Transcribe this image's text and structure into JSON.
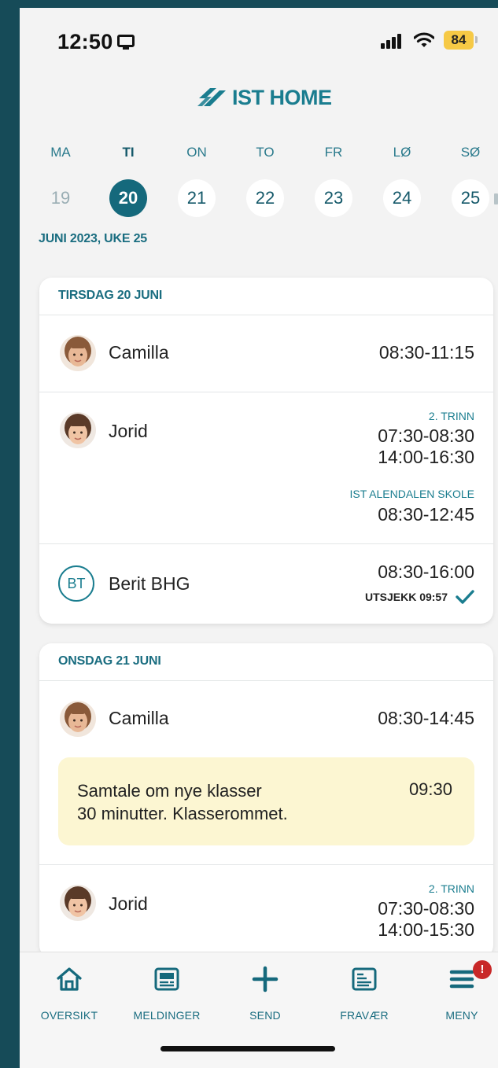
{
  "status_bar": {
    "time": "12:50",
    "battery": "84",
    "icons": [
      "screen-icon",
      "signal-icon",
      "wifi-icon"
    ]
  },
  "app": {
    "logo_text": "IST HOME",
    "accent": "#1a7d8f",
    "dark_accent": "#15697c"
  },
  "week": {
    "label": "JUNI 2023, UKE 25",
    "days": [
      {
        "name": "MA",
        "num": "19"
      },
      {
        "name": "TI",
        "num": "20"
      },
      {
        "name": "ON",
        "num": "21"
      },
      {
        "name": "TO",
        "num": "22"
      },
      {
        "name": "FR",
        "num": "23"
      },
      {
        "name": "LØ",
        "num": "24"
      },
      {
        "name": "SØ",
        "num": "25"
      }
    ]
  },
  "cards": [
    {
      "header": "TIRSDAG 20 JUNI",
      "rows": [
        {
          "name": "Camilla",
          "time": "08:30-11:15"
        },
        {
          "name": "Jorid",
          "group1": "2. TRINN",
          "time1a": "07:30-08:30",
          "time1b": "14:00-16:30",
          "group2": "IST ALENDALEN SKOLE",
          "time2": "08:30-12:45"
        },
        {
          "initials": "BT",
          "name": "Berit BHG",
          "time": "08:30-16:00",
          "checkout": "UTSJEKK 09:57"
        }
      ]
    },
    {
      "header": "ONSDAG 21 JUNI",
      "rows": [
        {
          "name": "Camilla",
          "time": "08:30-14:45",
          "note": {
            "title": "Samtale om nye klasser",
            "detail": "30 minutter. Klasserommet.",
            "time": "09:30"
          }
        },
        {
          "name": "Jorid",
          "group1": "2. TRINN",
          "time1a": "07:30-08:30",
          "time1b": "14:00-15:30"
        }
      ]
    }
  ],
  "tabbar": {
    "tabs": [
      {
        "label": "OVERSIKT",
        "icon": "home-icon"
      },
      {
        "label": "MELDINGER",
        "icon": "messages-icon"
      },
      {
        "label": "SEND",
        "icon": "plus-icon"
      },
      {
        "label": "FRAVÆR",
        "icon": "absence-icon"
      },
      {
        "label": "MENY",
        "icon": "menu-icon",
        "badge": "!"
      }
    ]
  }
}
